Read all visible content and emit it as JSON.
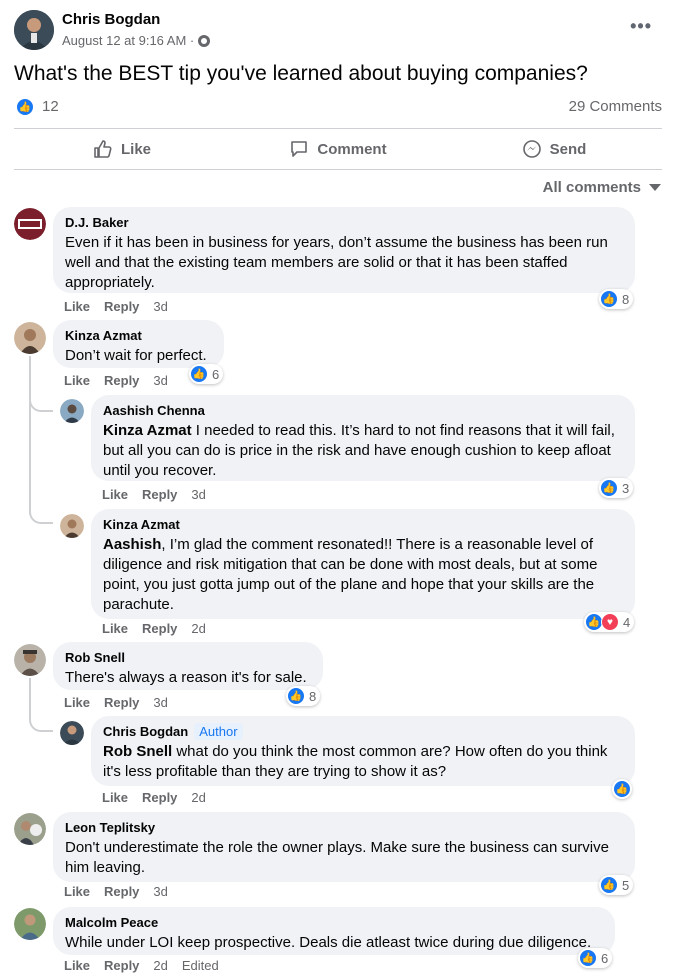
{
  "post": {
    "author": "Chris Bogdan",
    "meta": "August 12 at 9:16 AM ·",
    "text": "What's the BEST tip you've learned about buying companies?",
    "reaction_count": "12",
    "comments_label": "29 Comments"
  },
  "actions": {
    "like": "Like",
    "comment": "Comment",
    "send": "Send"
  },
  "sort_label": "All comments",
  "comment_actions": {
    "like": "Like",
    "reply": "Reply"
  },
  "comments": [
    {
      "name": "D.J. Baker",
      "text": "Even if it has been in business for years, don’t assume the business has been run well and that the existing team members are solid or that it has been staffed appropriately.",
      "time": "3d",
      "reactions": "8"
    },
    {
      "name": "Kinza Azmat",
      "text": "Don’t wait for perfect.",
      "time": "3d",
      "reactions": "6"
    },
    {
      "name": "Aashish Chenna",
      "mention": "Kinza Azmat",
      "text": " I needed to read this. It’s hard to not find reasons that it will fail, but all you can do is price in the risk and have enough cushion to keep afloat until you recover.",
      "time": "3d",
      "reactions": "3"
    },
    {
      "name": "Kinza Azmat",
      "mention": "Aashish",
      "text": ", I’m glad the comment resonated!! There is a reasonable level of diligence and risk mitigation that can be done with most deals, but at some point, you just gotta jump out of the plane and hope that your skills are the parachute.",
      "time": "2d",
      "reactions": "4"
    },
    {
      "name": "Rob Snell",
      "text": "There's always a reason it's for sale.",
      "time": "3d",
      "reactions": "8"
    },
    {
      "name": "Chris Bogdan",
      "badge": "Author",
      "mention": "Rob Snell",
      "text": " what do you think the most common are? How often do you think it's less profitable than they are trying to show it as?",
      "time": "2d"
    },
    {
      "name": "Leon Teplitsky",
      "text": "Don't underestimate the role the owner plays. Make sure the business can survive him leaving.",
      "time": "3d",
      "reactions": "5"
    },
    {
      "name": "Malcolm Peace",
      "text": "While under LOI keep prospective. Deals die atleast twice during due diligence.",
      "time": "2d",
      "edited": "Edited",
      "reactions": "6"
    }
  ],
  "colors": {
    "brand_blue": "#1877f2",
    "bubble": "#f0f2f5",
    "muted": "#65676b",
    "heart": "#f33e58"
  }
}
